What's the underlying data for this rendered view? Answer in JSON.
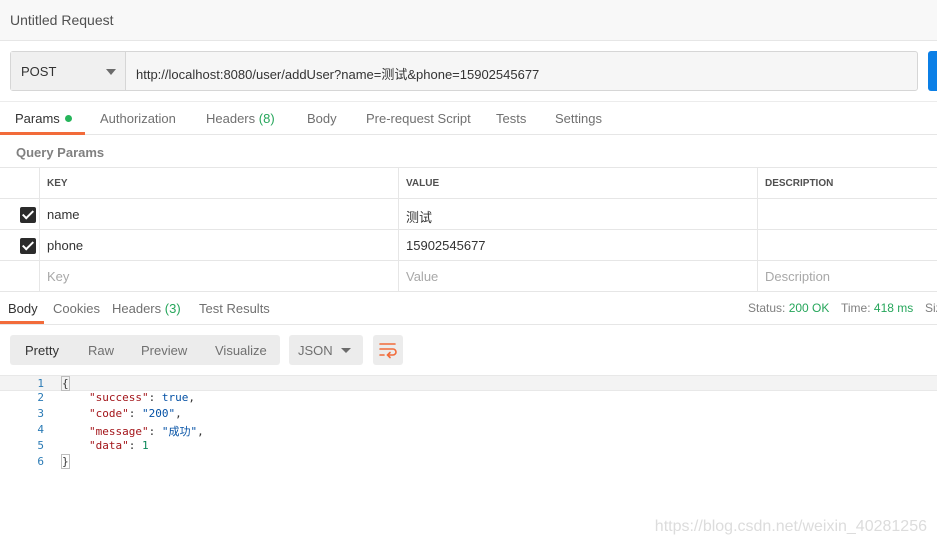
{
  "window": {
    "title": "Untitled Request"
  },
  "request": {
    "method": "POST",
    "url": "http://localhost:8080/user/addUser?name=测试&phone=15902545677"
  },
  "request_tabs": {
    "params": "Params",
    "authorization": "Authorization",
    "headers": "Headers",
    "headers_count": "(8)",
    "body": "Body",
    "pre_request": "Pre-request Script",
    "tests": "Tests",
    "settings": "Settings"
  },
  "query_params": {
    "section_title": "Query Params",
    "columns": {
      "key": "KEY",
      "value": "VALUE",
      "description": "DESCRIPTION"
    },
    "rows": [
      {
        "key": "name",
        "value": "测试",
        "description": ""
      },
      {
        "key": "phone",
        "value": "15902545677",
        "description": ""
      }
    ],
    "placeholders": {
      "key": "Key",
      "value": "Value",
      "description": "Description"
    }
  },
  "response_tabs": {
    "body": "Body",
    "cookies": "Cookies",
    "headers": "Headers",
    "headers_count": "(3)",
    "test_results": "Test Results"
  },
  "response_meta": {
    "status_label": "Status:",
    "status_value": "200 OK",
    "time_label": "Time:",
    "time_value": "418 ms",
    "size_label": "Siz"
  },
  "view_toolbar": {
    "pretty": "Pretty",
    "raw": "Raw",
    "preview": "Preview",
    "visualize": "Visualize",
    "format": "JSON"
  },
  "response_body": {
    "line_numbers": [
      "1",
      "2",
      "3",
      "4",
      "5",
      "6"
    ],
    "open_brace": "{",
    "close_brace": "}",
    "fields": [
      {
        "key": "\"success\"",
        "value": "true"
      },
      {
        "key": "\"code\"",
        "value": "\"200\""
      },
      {
        "key": "\"message\"",
        "value": "\"成功\""
      },
      {
        "key": "\"data\"",
        "value": "1"
      }
    ]
  },
  "watermark": "https://blog.csdn.net/weixin_40281256",
  "colors": {
    "accent": "#f26b3a",
    "success": "#26a65b",
    "send": "#0b7fe6"
  }
}
